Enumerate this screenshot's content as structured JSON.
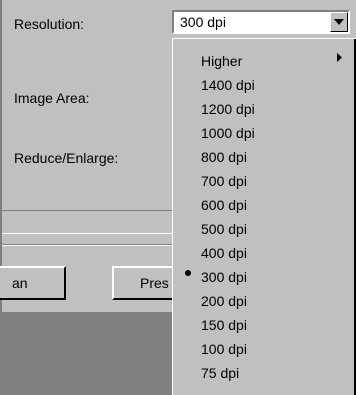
{
  "form": {
    "resolution_label": "Resolution:",
    "image_area_label": "Image Area:",
    "reduce_enlarge_label": "Reduce/Enlarge:"
  },
  "resolution_select": {
    "value": "300 dpi"
  },
  "buttons": {
    "scan_label": "an",
    "preview_label": "Pres"
  },
  "resolution_menu": {
    "submenu_label": "Higher",
    "selected": "300 dpi",
    "items": [
      "1400 dpi",
      "1200 dpi",
      "1000 dpi",
      "800 dpi",
      "700 dpi",
      "600 dpi",
      "500 dpi",
      "400 dpi",
      "300 dpi",
      "200 dpi",
      "150 dpi",
      "100 dpi",
      "75 dpi"
    ]
  },
  "icons": {
    "dropdown_button": "chevron-down-icon",
    "submenu_arrow": "chevron-right-icon",
    "selected_marker": "bullet-icon"
  },
  "colors": {
    "face": "#c0c0c0",
    "shadow": "#808080",
    "highlight": "#ffffff",
    "field": "#ffffff"
  }
}
